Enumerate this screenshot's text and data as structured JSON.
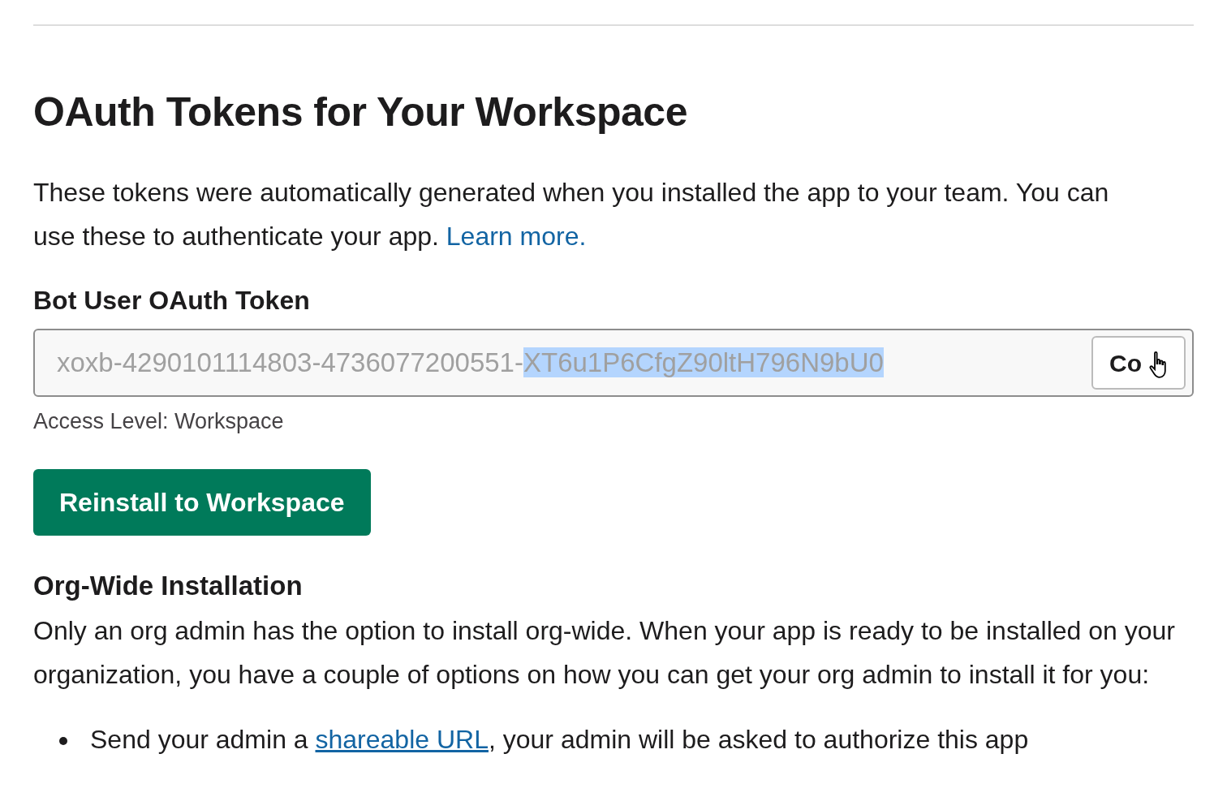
{
  "heading": "OAuth Tokens for Your Workspace",
  "intro": {
    "text": "These tokens were automatically generated when you installed the app to your team. You can use these to authenticate your app.",
    "link": "Learn more."
  },
  "token_section": {
    "label": "Bot User OAuth Token",
    "value": [
      {
        "text": "xoxb-4290101114803-4736077200551-",
        "selected": false
      },
      {
        "text": "XT6u1P6CfgZ90ltH796N9bU0",
        "selected": true
      }
    ],
    "copy_button": "Co",
    "access_level": "Access Level: Workspace"
  },
  "reinstall_button": "Reinstall to Workspace",
  "org_wide": {
    "title": "Org-Wide Installation",
    "text": "Only an org admin has the option to install org-wide. When your app is ready to be installed on your organization, you have a couple of options on how you can get your org admin to install it for you:",
    "bullets": [
      {
        "before": "Send your admin a ",
        "link": "shareable URL",
        "after": ", your admin will be asked to authorize this app"
      }
    ]
  }
}
